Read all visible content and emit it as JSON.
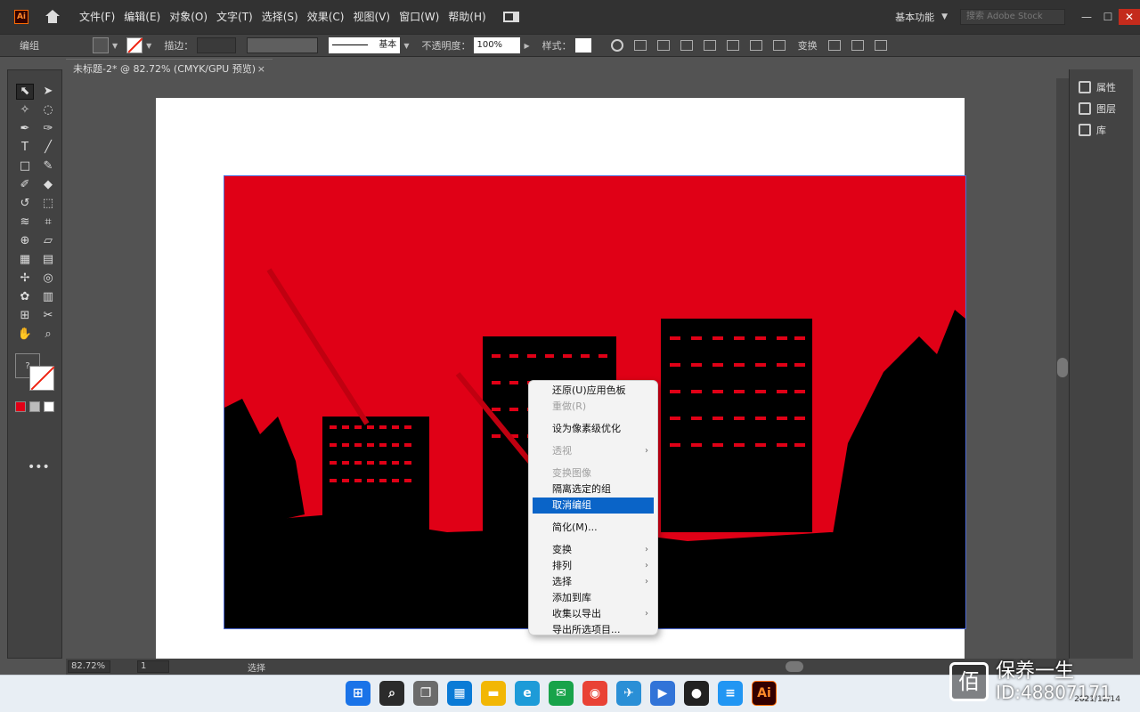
{
  "menubar": {
    "logo": "Ai",
    "items": [
      "文件(F)",
      "编辑(E)",
      "对象(O)",
      "文字(T)",
      "选择(S)",
      "效果(C)",
      "视图(V)",
      "窗口(W)",
      "帮助(H)"
    ],
    "workspace": "基本功能",
    "stock_placeholder": "搜索 Adobe Stock",
    "win_min": "—",
    "win_max": "☐",
    "win_close": "✕"
  },
  "controlbar": {
    "object_type": "编组",
    "stroke_label": "描边：",
    "stroke_style": "基本",
    "opacity_label": "不透明度：",
    "opacity_value": "100%",
    "style_label": "样式：",
    "transform_label": "变换"
  },
  "document": {
    "tab_title": "未标题-2* @ 82.72% (CMYK/GPU 预览)",
    "close": "×"
  },
  "right_panel": {
    "items": [
      "属性",
      "图层",
      "库"
    ]
  },
  "statusbar": {
    "zoom": "82.72%",
    "page": "1",
    "tool": "选择"
  },
  "context_menu": {
    "items": [
      {
        "label": "还原(U)应用色板",
        "disabled": false
      },
      {
        "label": "重做(R)",
        "disabled": true
      },
      {
        "label": "设为像素级优化",
        "disabled": false
      },
      {
        "label": "透视",
        "disabled": true
      },
      {
        "label": "隔离选定的组",
        "disabled": false
      },
      {
        "label": "取消编组",
        "disabled": false
      },
      {
        "label": "简化(M)...",
        "disabled": false
      },
      {
        "label": "变换",
        "disabled": false
      },
      {
        "label": "排列",
        "disabled": false
      },
      {
        "label": "选择",
        "disabled": false
      },
      {
        "label": "添加到库",
        "disabled": false
      },
      {
        "label": "收集以导出",
        "disabled": false
      },
      {
        "label": "导出所选项目...",
        "disabled": false
      }
    ],
    "extra_disabled": "变换图像",
    "highlighted": "取消编组"
  },
  "taskbar": {
    "date": "2021/12/14",
    "ai_label": "Ai"
  },
  "watermark": {
    "logo": "佰",
    "title": "保养一生",
    "id": "ID:48807171"
  },
  "colors": {
    "artwork_red": "#e00016",
    "selection_blue": "#4f6bd8",
    "menu_highlight": "#0a64c8"
  }
}
